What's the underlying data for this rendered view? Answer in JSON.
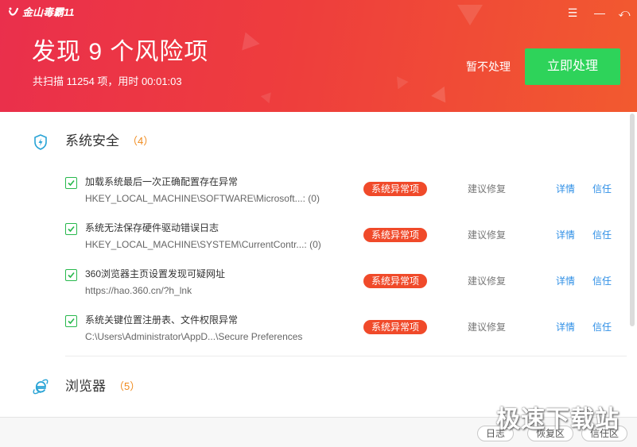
{
  "app": {
    "name": "金山毒霸11"
  },
  "window_controls": {
    "menu": "☰",
    "minimize": "—",
    "back": "⤺"
  },
  "header": {
    "title": "发现 9 个风险项",
    "summary": "共扫描 11254 项，用时 00:01:03",
    "skip_label": "暂不处理",
    "fix_label": "立即处理"
  },
  "sections": [
    {
      "title": "系统安全",
      "count": "（4）",
      "icon": "shield-icon",
      "items": [
        {
          "title": "加载系统最后一次正确配置存在异常",
          "path": "HKEY_LOCAL_MACHINE\\SOFTWARE\\Microsoft...: (0)",
          "badge": "系统异常项",
          "suggest": "建议修复",
          "details": "详情",
          "trust": "信任"
        },
        {
          "title": "系统无法保存硬件驱动错误日志",
          "path": "HKEY_LOCAL_MACHINE\\SYSTEM\\CurrentContr...: (0)",
          "badge": "系统异常项",
          "suggest": "建议修复",
          "details": "详情",
          "trust": "信任"
        },
        {
          "title": "360浏览器主页设置发现可疑网址",
          "path": "https://hao.360.cn/?h_lnk",
          "badge": "系统异常项",
          "suggest": "建议修复",
          "details": "详情",
          "trust": "信任"
        },
        {
          "title": "系统关键位置注册表、文件权限异常",
          "path": "C:\\Users\\Administrator\\AppD...\\Secure Preferences",
          "badge": "系统异常项",
          "suggest": "建议修复",
          "details": "详情",
          "trust": "信任"
        }
      ]
    },
    {
      "title": "浏览器",
      "count": "（5）",
      "icon": "ie-icon"
    }
  ],
  "footer": {
    "log_label": "日志",
    "restore_label": "恢复区",
    "trust_label": "信任区"
  },
  "watermark": "极速下载站",
  "colors": {
    "header_start": "#ea2f4c",
    "header_end": "#f25a2f",
    "fix_button": "#2ed35a",
    "badge": "#f04a2a",
    "link": "#2f8fe6",
    "count": "#f08a1c"
  }
}
